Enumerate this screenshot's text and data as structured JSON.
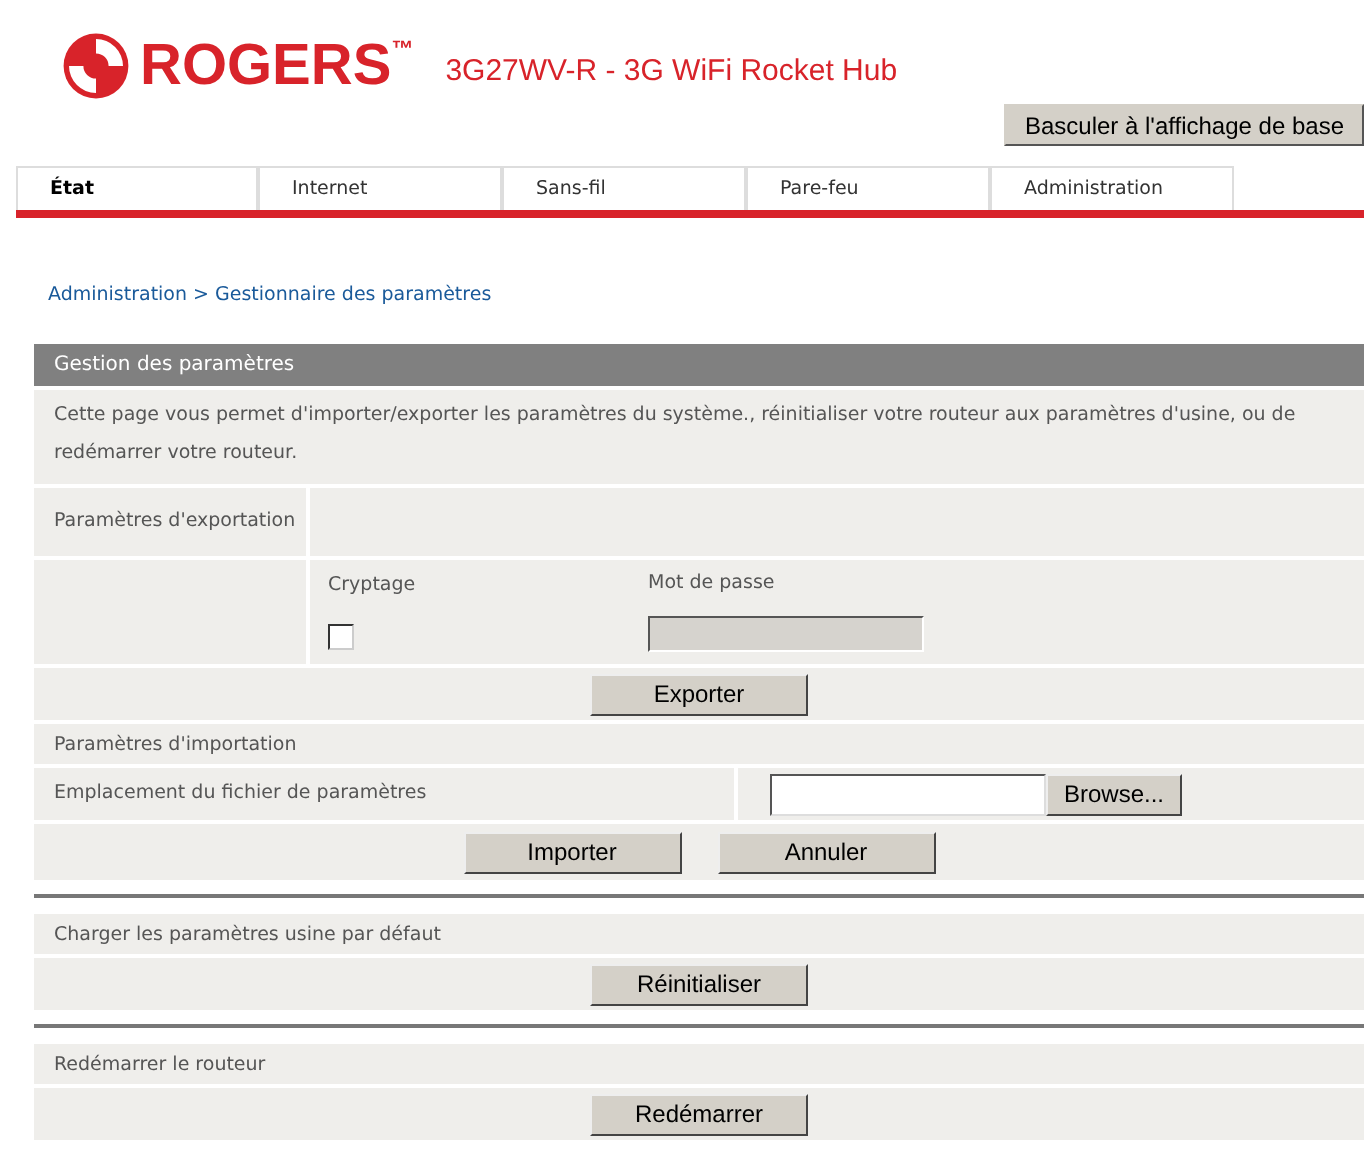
{
  "header": {
    "brand": "ROGERS",
    "trademark": "™",
    "product": "3G27WV-R - 3G WiFi Rocket Hub",
    "switch_button": "Basculer à l'affichage de base"
  },
  "tabs": [
    {
      "label": "État",
      "selected": true
    },
    {
      "label": "Internet",
      "selected": false
    },
    {
      "label": "Sans-fil",
      "selected": false
    },
    {
      "label": "Pare-feu",
      "selected": false
    },
    {
      "label": "Administration",
      "selected": false
    }
  ],
  "breadcrumb": "Administration > Gestionnaire des paramètres",
  "panel": {
    "title": "Gestion des paramètres",
    "description": "Cette page vous permet d'importer/exporter les paramètres du système., réinitialiser votre routeur aux paramètres d'usine, ou de redémarrer votre routeur.",
    "export": {
      "label": "Paramètres d'exportation",
      "encryption_label": "Cryptage",
      "encryption_checked": false,
      "password_label": "Mot de passe",
      "button": "Exporter"
    },
    "import": {
      "label": "Paramètres d'importation",
      "location_label": "Emplacement du fichier de paramètres",
      "browse_button": "Browse...",
      "import_button": "Importer",
      "cancel_button": "Annuler"
    },
    "factory": {
      "label": "Charger les paramètres usine par défaut",
      "button": "Réinitialiser"
    },
    "reboot": {
      "label": "Redémarrer le routeur",
      "button": "Redémarrer"
    }
  }
}
